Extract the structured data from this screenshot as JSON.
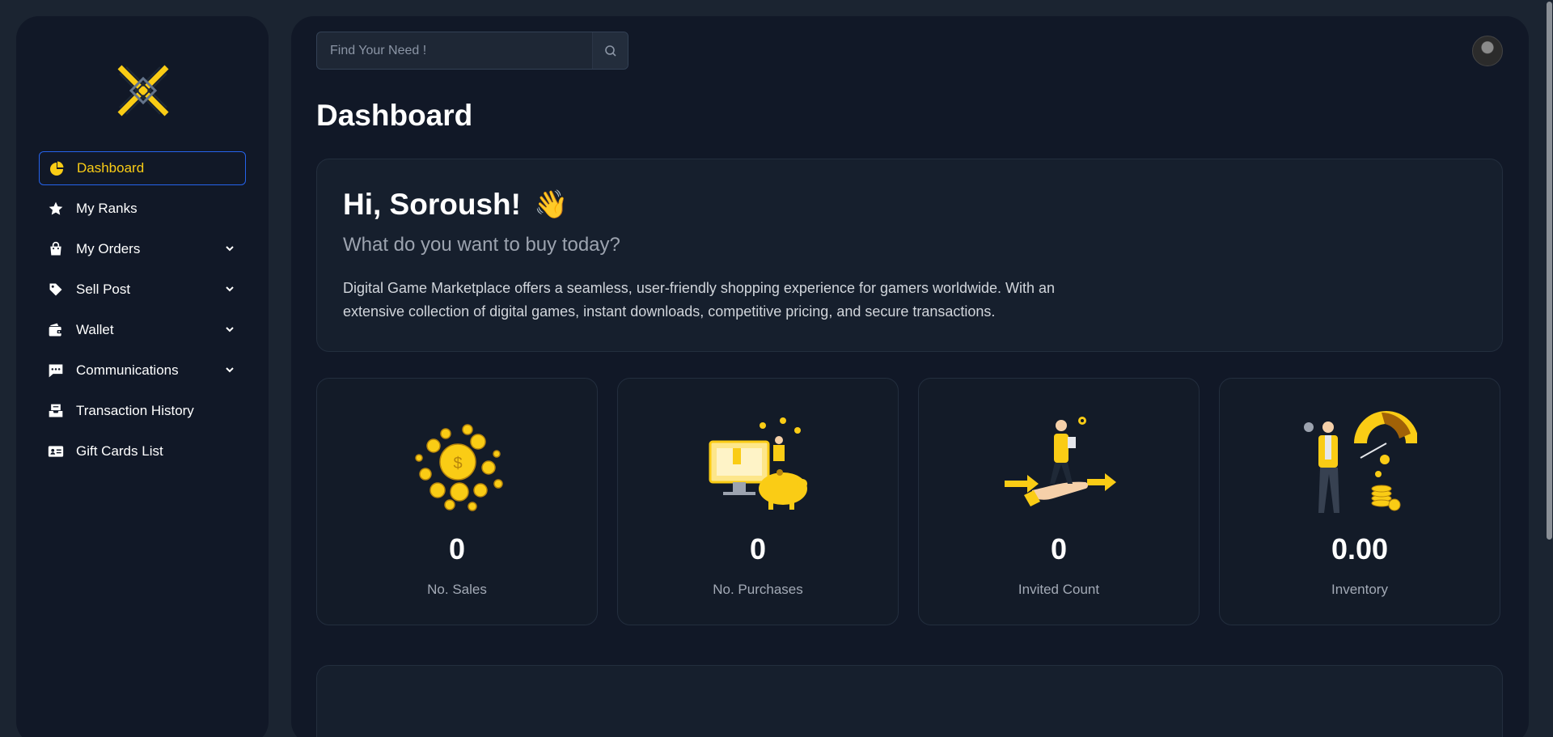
{
  "brand": {
    "accent": "#facc15",
    "active_border": "#2563eb"
  },
  "sidebar": {
    "items": [
      {
        "label": "Dashboard",
        "icon": "pie-chart-icon",
        "active": true,
        "expandable": false
      },
      {
        "label": "My Ranks",
        "icon": "star-icon",
        "active": false,
        "expandable": false
      },
      {
        "label": "My Orders",
        "icon": "shopping-bag-icon",
        "active": false,
        "expandable": true
      },
      {
        "label": "Sell Post",
        "icon": "tag-icon",
        "active": false,
        "expandable": true
      },
      {
        "label": "Wallet",
        "icon": "wallet-icon",
        "active": false,
        "expandable": true
      },
      {
        "label": "Communications",
        "icon": "chat-icon",
        "active": false,
        "expandable": true
      },
      {
        "label": "Transaction History",
        "icon": "inbox-icon",
        "active": false,
        "expandable": false
      },
      {
        "label": "Gift Cards List",
        "icon": "id-card-icon",
        "active": false,
        "expandable": false
      }
    ]
  },
  "search": {
    "placeholder": "Find Your Need !",
    "value": ""
  },
  "page": {
    "title": "Dashboard"
  },
  "welcome": {
    "greeting": "Hi, Soroush!",
    "wave": "👋",
    "subtitle": "What do you want to buy today?",
    "description": "Digital Game Marketplace offers a seamless, user-friendly shopping experience for gamers worldwide. With an extensive collection of digital games, instant downloads, competitive pricing, and secure transactions."
  },
  "stats": [
    {
      "value": "0",
      "label": "No. Sales",
      "illustration": "coins-illustration"
    },
    {
      "value": "0",
      "label": "No. Purchases",
      "illustration": "piggy-bank-illustration"
    },
    {
      "value": "0",
      "label": "Invited Count",
      "illustration": "referral-illustration"
    },
    {
      "value": "0.00",
      "label": "Inventory",
      "illustration": "gauge-illustration"
    }
  ]
}
